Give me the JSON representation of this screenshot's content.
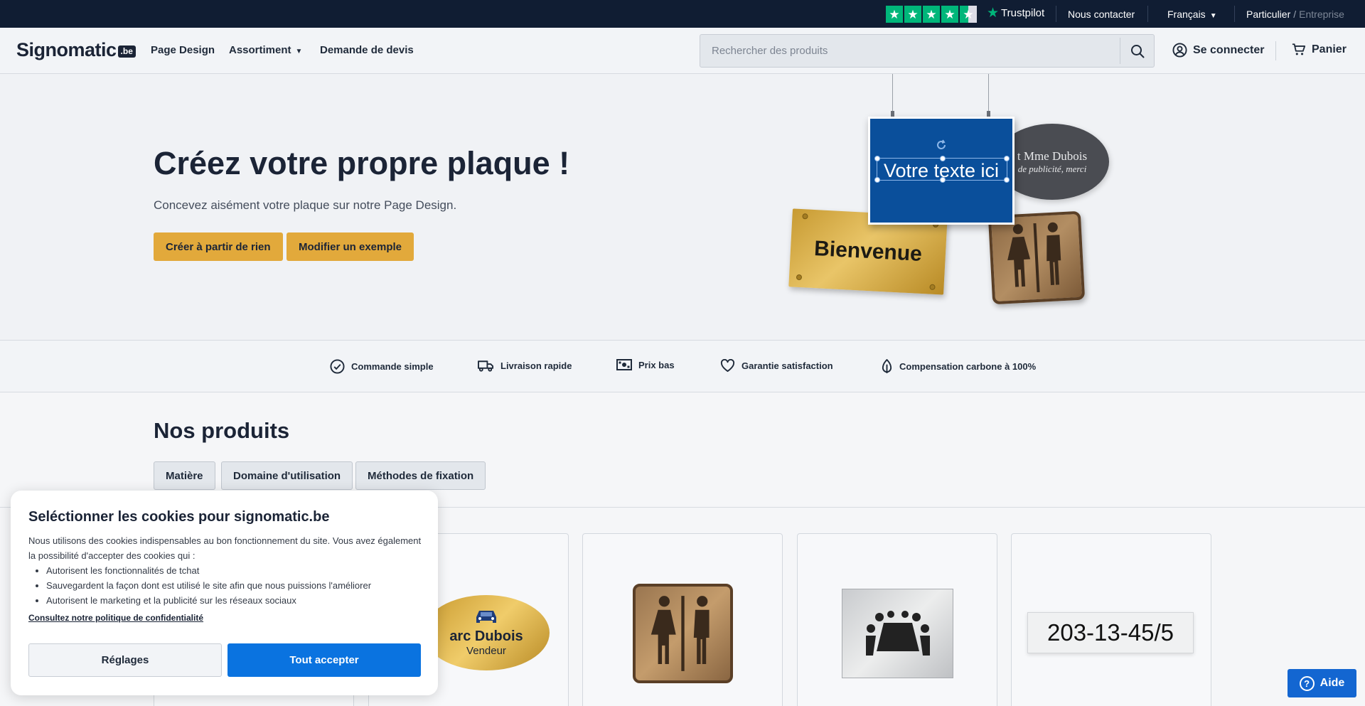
{
  "topbar": {
    "trustpilot_label": "Trustpilot",
    "trustpilot_rating_stars": 4.5,
    "contact": "Nous contacter",
    "language": "Français",
    "account_type_active": "Particulier",
    "account_type_separator": "/",
    "account_type_inactive": "Entreprise"
  },
  "header": {
    "logo_text": "Signomatic",
    "logo_badge": ".be",
    "nav": {
      "page_design": "Page Design",
      "assortment": "Assortiment",
      "quote": "Demande de devis"
    },
    "search": {
      "placeholder": "Rechercher des produits"
    },
    "login": "Se connecter",
    "cart": "Panier"
  },
  "hero": {
    "title": "Créez votre propre plaque !",
    "subtitle": "Concevez aisément votre plaque sur notre Page Design.",
    "btn_scratch": "Créer à partir de rien",
    "btn_example": "Modifier un exemple",
    "images": {
      "gold_plaque": "Bienvenue",
      "blue_plaque": "Votre texte ici",
      "oval_line1": "t Mme Dubois",
      "oval_line2": "de publicité, merci"
    }
  },
  "features": [
    {
      "icon": "check-circle-icon",
      "label": "Commande simple"
    },
    {
      "icon": "truck-icon",
      "label": "Livraison rapide"
    },
    {
      "icon": "money-icon",
      "label": "Prix bas"
    },
    {
      "icon": "heart-icon",
      "label": "Garantie satisfaction"
    },
    {
      "icon": "leaf-icon",
      "label": "Compensation carbone à 100%"
    }
  ],
  "products": {
    "title": "Nos produits",
    "filters": [
      "Matière",
      "Domaine d'utilisation",
      "Méthodes de fixation"
    ],
    "cards": {
      "badge_name": "arc Dubois",
      "badge_role": "Vendeur",
      "number_plate": "203-13-45/5"
    }
  },
  "cookie": {
    "title": "Seléctionner les cookies pour signomatic.be",
    "intro": "Nous utilisons des cookies indispensables au bon fonctionnement du site. Vous avez également la possibilité d'accepter des cookies qui :",
    "items": [
      "Autorisent les fonctionnalités de tchat",
      "Sauvegardent la façon dont est utilisé le site afin que nous puissions l'améliorer",
      "Autorisent le marketing et la publicité sur les réseaux sociaux"
    ],
    "policy_link": "Consultez notre politique de confidentialité",
    "settings_button": "Réglages",
    "accept_button": "Tout accepter"
  },
  "help": {
    "label": "Aide"
  },
  "colors": {
    "topbar": "#101d33",
    "accent_gold": "#e2a93b",
    "primary_blue": "#0a73e0",
    "trustpilot_green": "#00b67a"
  }
}
